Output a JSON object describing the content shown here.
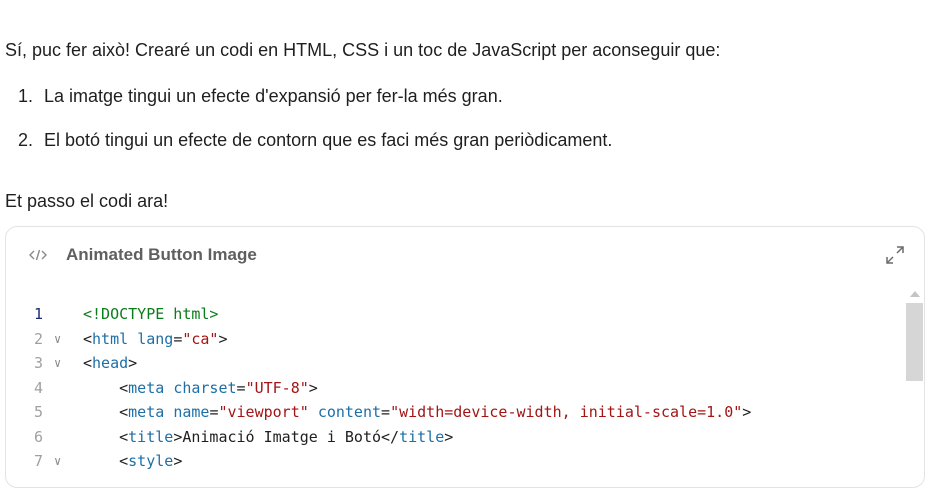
{
  "message": {
    "intro": "Sí, puc fer això! Crearé un codi en HTML, CSS i un toc de JavaScript per aconseguir que:",
    "list": [
      {
        "num": "1.",
        "text": "La imatge tingui un efecte d'expansió per fer-la més gran."
      },
      {
        "num": "2.",
        "text": "El botó tingui un efecte de contorn que es faci més gran periòdicament."
      }
    ],
    "outro": "Et passo el codi ara!"
  },
  "artifact": {
    "title": "Animated Button Image",
    "icon": "code-icon",
    "expand_icon": "expand-icon",
    "scroll_position": 0.0,
    "code_lines": [
      {
        "n": "1",
        "fold": false,
        "tokens": [
          {
            "c": "t-doctype",
            "t": "<!DOCTYPE html>"
          }
        ]
      },
      {
        "n": "2",
        "fold": true,
        "tokens": [
          {
            "c": "t-punct",
            "t": "<"
          },
          {
            "c": "t-tag",
            "t": "html"
          },
          {
            "c": "t-punct",
            "t": " "
          },
          {
            "c": "t-attr",
            "t": "lang"
          },
          {
            "c": "t-punct",
            "t": "="
          },
          {
            "c": "t-str",
            "t": "\"ca\""
          },
          {
            "c": "t-punct",
            "t": ">"
          }
        ]
      },
      {
        "n": "3",
        "fold": true,
        "tokens": [
          {
            "c": "t-punct",
            "t": "<"
          },
          {
            "c": "t-tag",
            "t": "head"
          },
          {
            "c": "t-punct",
            "t": ">"
          }
        ]
      },
      {
        "n": "4",
        "fold": false,
        "tokens": [
          {
            "c": "t-punct",
            "t": "    <"
          },
          {
            "c": "t-tag",
            "t": "meta"
          },
          {
            "c": "t-punct",
            "t": " "
          },
          {
            "c": "t-attr",
            "t": "charset"
          },
          {
            "c": "t-punct",
            "t": "="
          },
          {
            "c": "t-str",
            "t": "\"UTF-8\""
          },
          {
            "c": "t-punct",
            "t": ">"
          }
        ]
      },
      {
        "n": "5",
        "fold": false,
        "tokens": [
          {
            "c": "t-punct",
            "t": "    <"
          },
          {
            "c": "t-tag",
            "t": "meta"
          },
          {
            "c": "t-punct",
            "t": " "
          },
          {
            "c": "t-attr",
            "t": "name"
          },
          {
            "c": "t-punct",
            "t": "="
          },
          {
            "c": "t-str",
            "t": "\"viewport\""
          },
          {
            "c": "t-punct",
            "t": " "
          },
          {
            "c": "t-attr",
            "t": "content"
          },
          {
            "c": "t-punct",
            "t": "="
          },
          {
            "c": "t-str",
            "t": "\"width=device-width, initial-scale=1.0\""
          },
          {
            "c": "t-punct",
            "t": ">"
          }
        ]
      },
      {
        "n": "6",
        "fold": false,
        "tokens": [
          {
            "c": "t-punct",
            "t": "    <"
          },
          {
            "c": "t-tag",
            "t": "title"
          },
          {
            "c": "t-punct",
            "t": ">Animació Imatge i Botó</"
          },
          {
            "c": "t-tag",
            "t": "title"
          },
          {
            "c": "t-punct",
            "t": ">"
          }
        ]
      },
      {
        "n": "7",
        "fold": true,
        "tokens": [
          {
            "c": "t-punct",
            "t": "    <"
          },
          {
            "c": "t-tag",
            "t": "style"
          },
          {
            "c": "t-punct",
            "t": ">"
          }
        ]
      }
    ]
  }
}
